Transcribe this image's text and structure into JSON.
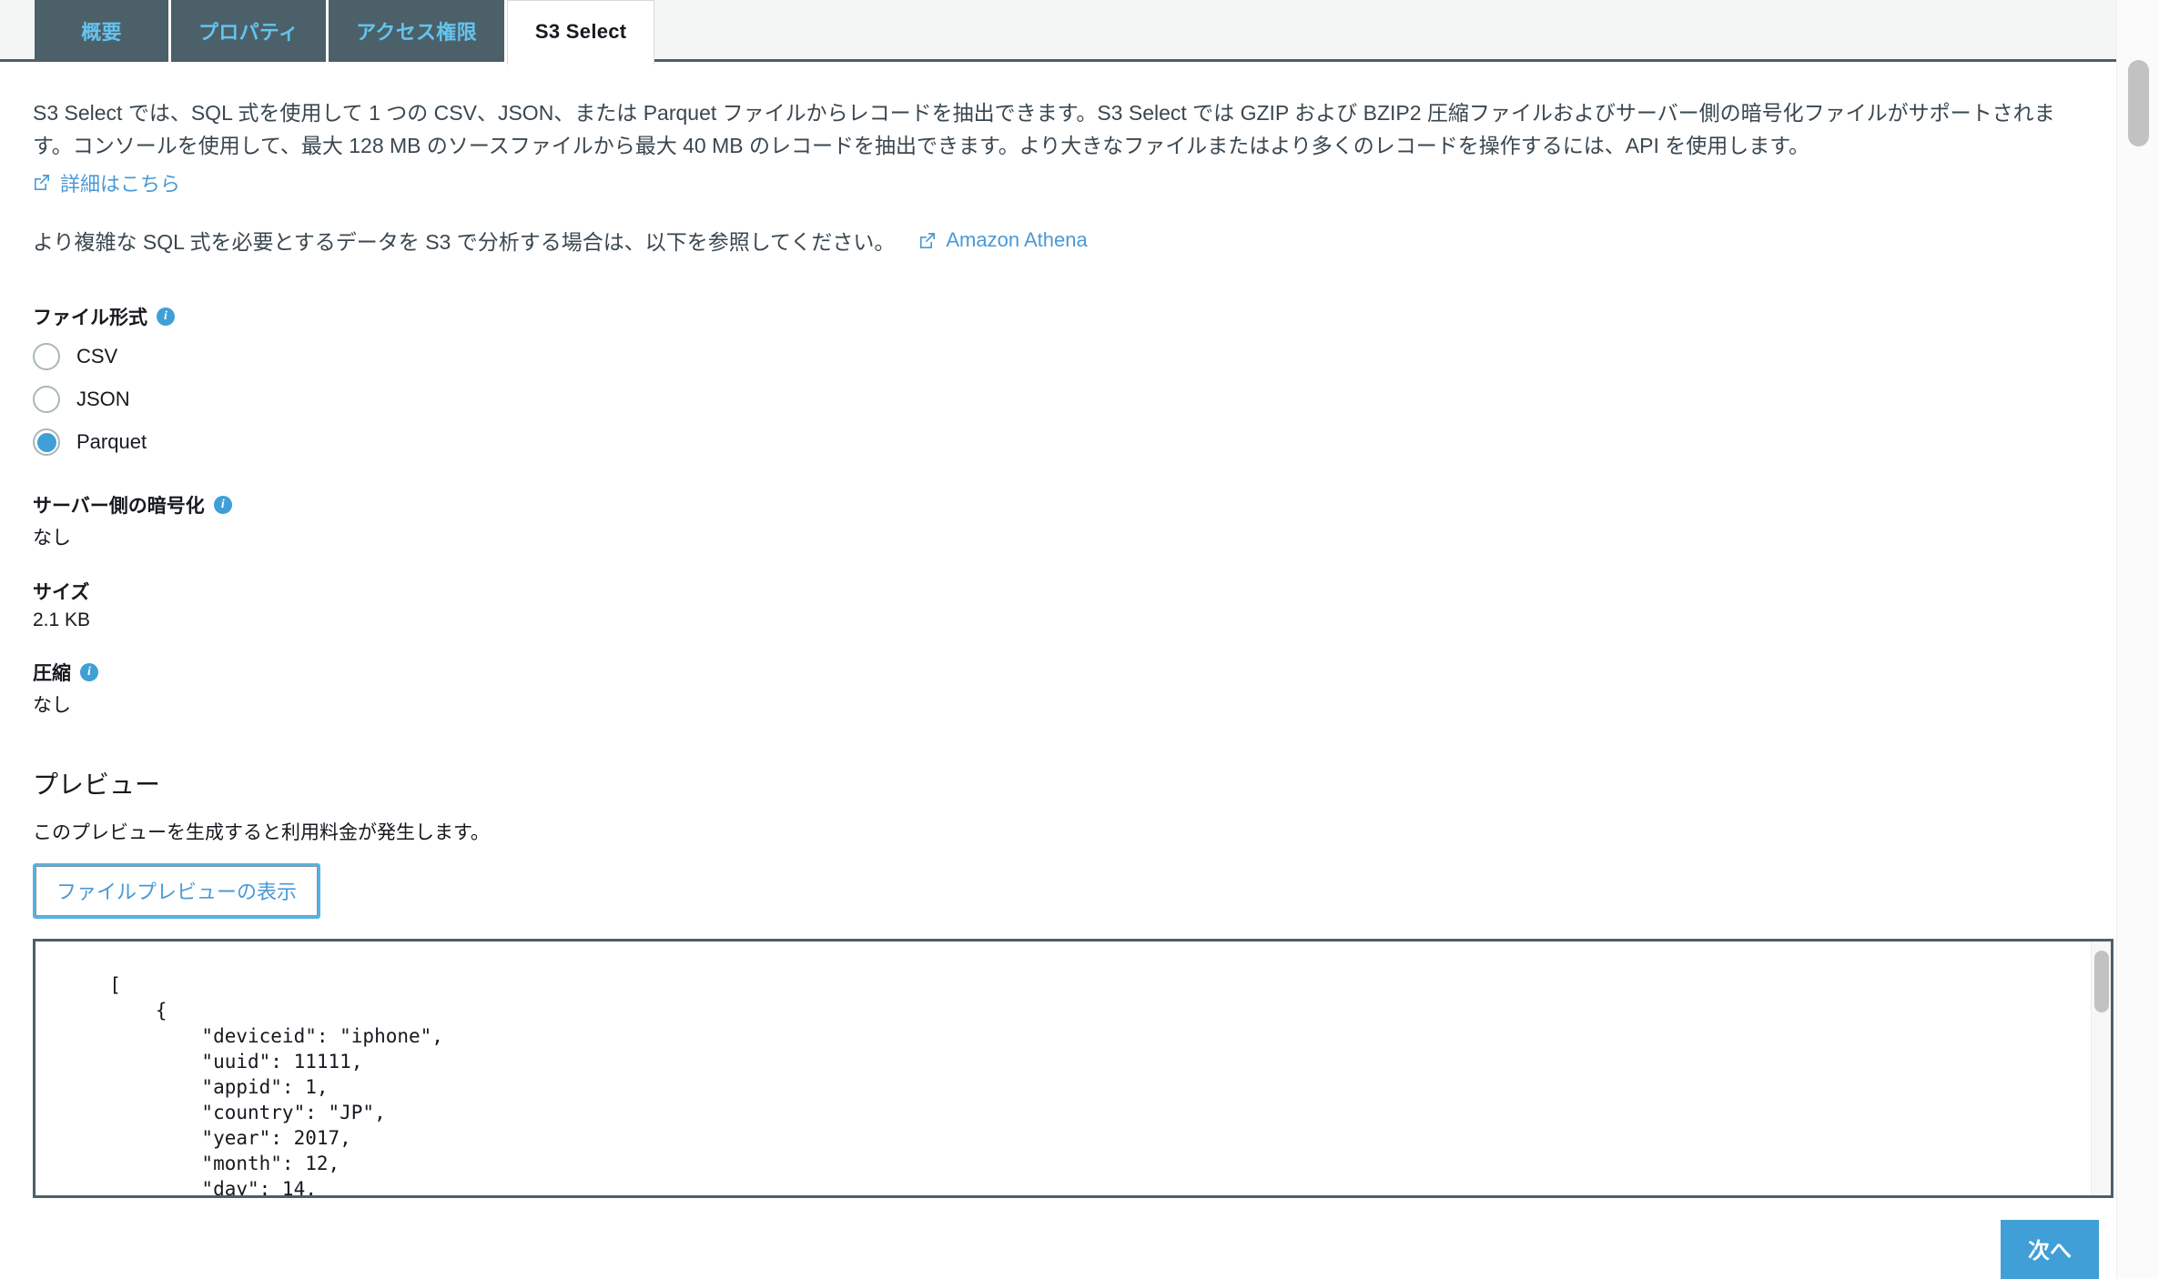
{
  "tabs": [
    {
      "label": "概要",
      "active": false
    },
    {
      "label": "プロパティ",
      "active": false
    },
    {
      "label": "アクセス権限",
      "active": false
    },
    {
      "label": "S3 Select",
      "active": true
    }
  ],
  "intro": {
    "paragraph": "S3 Select では、SQL 式を使用して 1 つの CSV、JSON、または Parquet ファイルからレコードを抽出できます。S3 Select では GZIP および BZIP2 圧縮ファイルおよびサーバー側の暗号化ファイルがサポートされます。コンソールを使用して、最大 128 MB のソースファイルから最大 40 MB のレコードを抽出できます。より大きなファイルまたはより多くのレコードを操作するには、API を使用します。",
    "learn_more_link": "詳細はこちら",
    "second_paragraph": "より複雑な SQL 式を必要とするデータを S3 で分析する場合は、以下を参照してください。",
    "athena_link": "Amazon Athena"
  },
  "file_format": {
    "label": "ファイル形式",
    "options": [
      {
        "label": "CSV",
        "selected": false
      },
      {
        "label": "JSON",
        "selected": false
      },
      {
        "label": "Parquet",
        "selected": true
      }
    ]
  },
  "encryption": {
    "label": "サーバー側の暗号化",
    "value": "なし"
  },
  "size": {
    "label": "サイズ",
    "value": "2.1 KB"
  },
  "compression": {
    "label": "圧縮",
    "value": "なし"
  },
  "preview": {
    "heading": "プレビュー",
    "note": "このプレビューを生成すると利用料金が発生します。",
    "button_label": "ファイルプレビューの表示",
    "code": "  [\n      {\n          \"deviceid\": \"iphone\",\n          \"uuid\": 11111,\n          \"appid\": 1,\n          \"country\": \"JP\",\n          \"year\": 2017,\n          \"month\": 12,\n          \"day\": 14,"
  },
  "footer": {
    "next_label": "次へ"
  },
  "colors": {
    "tab_bar": "#4c6069",
    "tab_text": "#64c3ee",
    "accent_blue": "#3f9fd6",
    "link_blue": "#4a9ad4",
    "body_text": "#16191f",
    "page_bg": "#f4f5f5"
  }
}
